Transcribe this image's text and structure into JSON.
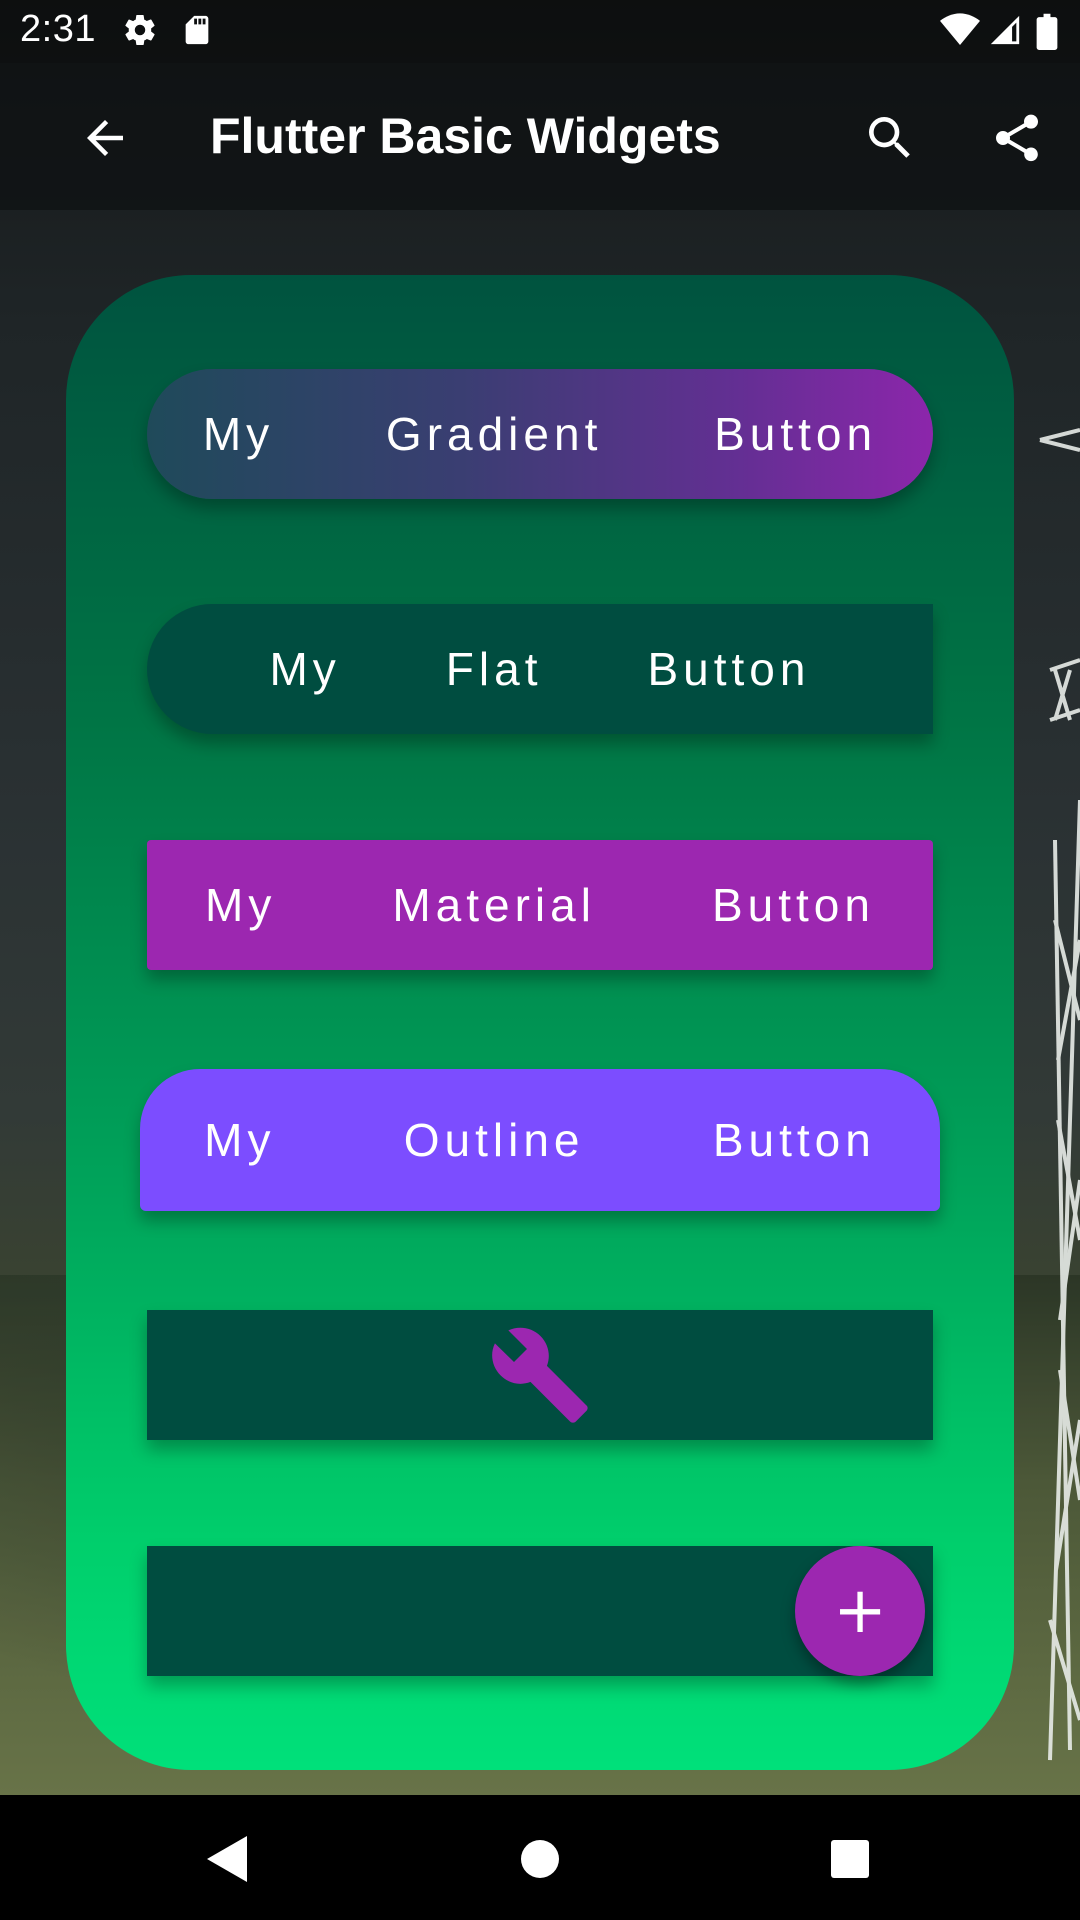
{
  "status_bar": {
    "time": "2:31",
    "icons": [
      "gear-icon",
      "sd-card-icon",
      "wifi-icon",
      "signal-icon",
      "battery-icon"
    ]
  },
  "app_bar": {
    "title": "Flutter Basic Widgets",
    "icons": [
      "back-arrow-icon",
      "search-icon",
      "share-icon"
    ]
  },
  "buttons": {
    "gradient": {
      "words": [
        "My",
        "Gradient",
        "Button"
      ]
    },
    "flat": {
      "words": [
        "My",
        "Flat",
        "Button"
      ]
    },
    "material": {
      "words": [
        "My",
        "Material",
        "Button"
      ]
    },
    "outline": {
      "words": [
        "My",
        "Outline",
        "Button"
      ]
    },
    "icon_button": {
      "icon": "wrench-icon"
    },
    "fab": {
      "symbol": "+",
      "icon": "add-icon"
    }
  },
  "colors": {
    "card_top": "#00533f",
    "card_bottom": "#00e07a",
    "flat_button": "#004d40",
    "material_button": "#9c27b0",
    "outline_button": "#7c4dff",
    "fab": "#9c27b0"
  },
  "nav_bar": {
    "icons": [
      "back-triangle-icon",
      "home-circle-icon",
      "recents-square-icon"
    ]
  }
}
